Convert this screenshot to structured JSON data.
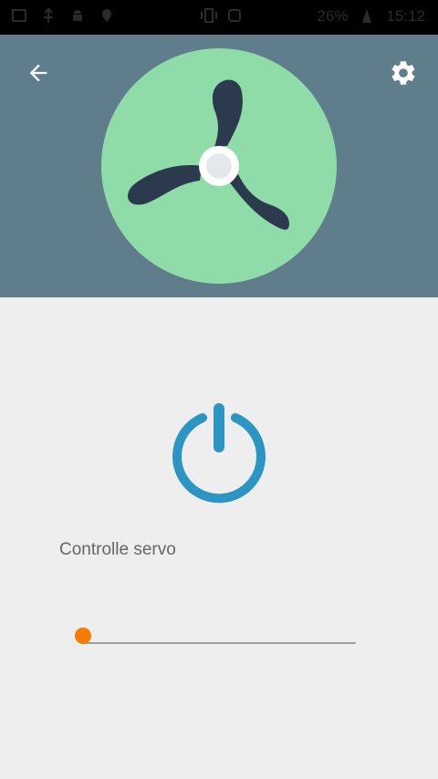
{
  "status_bar": {
    "battery": "26%",
    "time": "15:12"
  },
  "header": {
    "background_color": "#607d8b",
    "back_icon": "arrow-back-icon",
    "settings_icon": "gear-icon",
    "fan_icon": "fan-icon",
    "fan_circle_color": "#8fdca8",
    "fan_blade_color": "#2b3a4d"
  },
  "power": {
    "icon": "power-icon",
    "color": "#2b95c3"
  },
  "servo": {
    "label": "Controlle servo",
    "slider_value": 0,
    "accent_color": "#f57c00"
  }
}
